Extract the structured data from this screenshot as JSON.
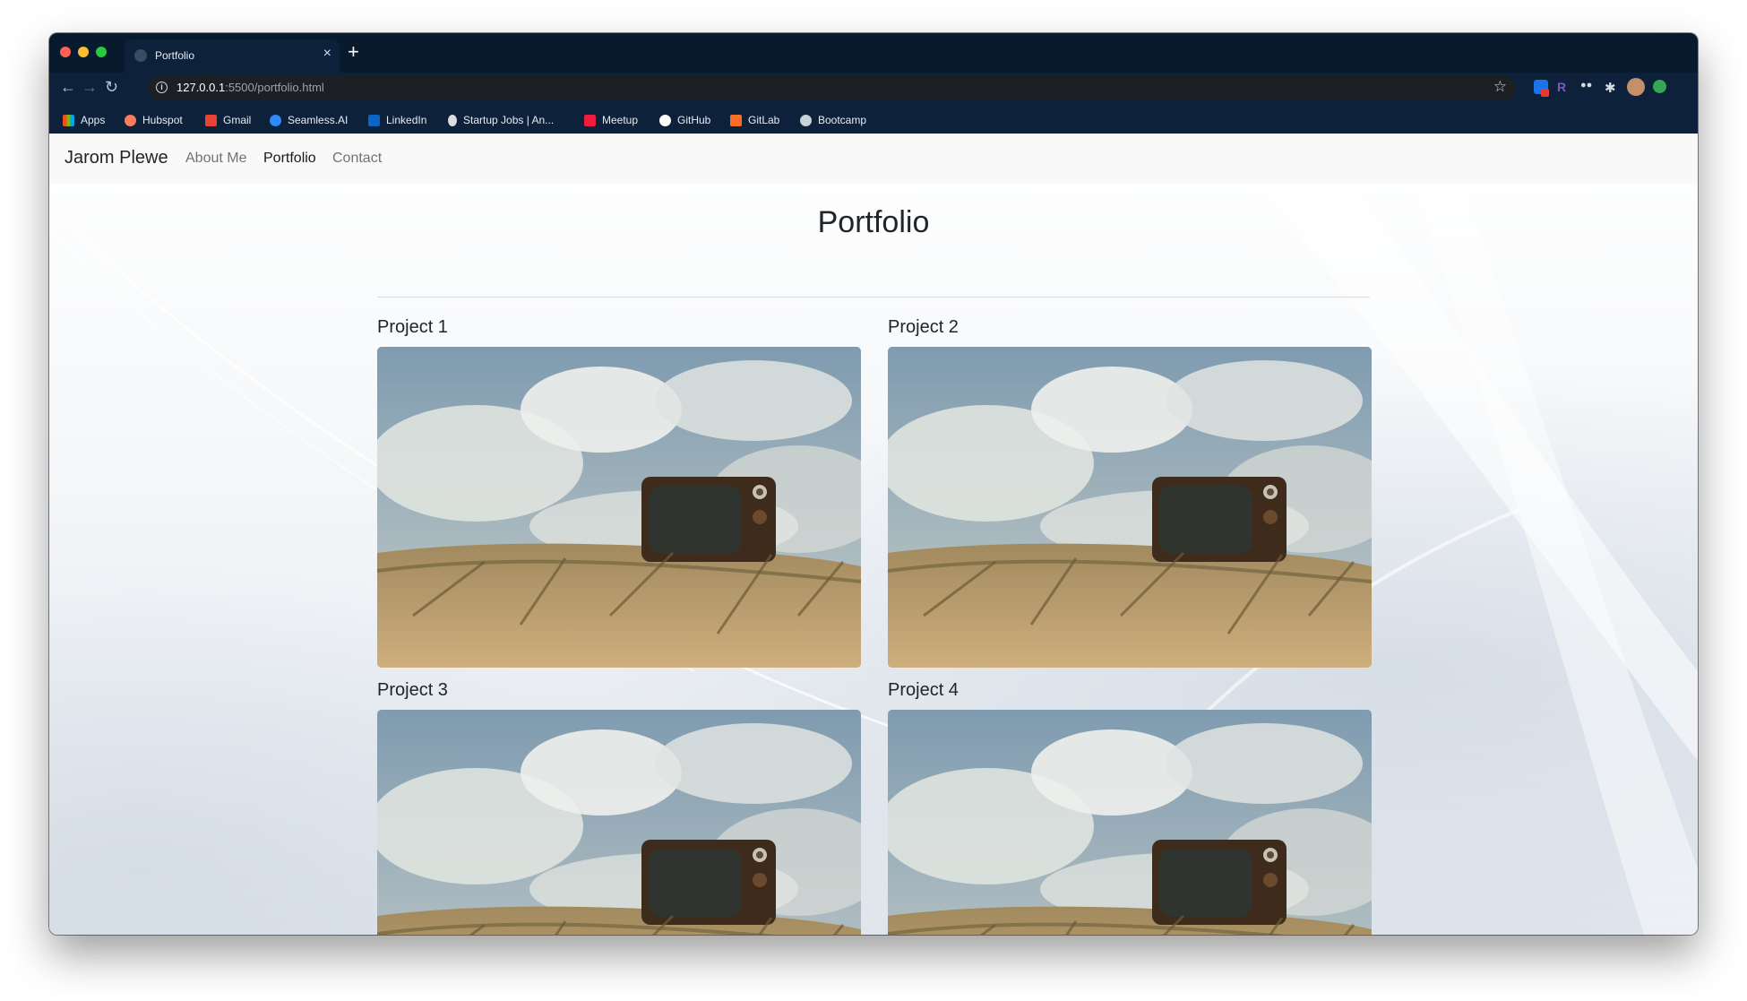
{
  "browser": {
    "tab_title": "Portfolio",
    "new_tab_symbol": "+",
    "tab_close_symbol": "×",
    "url_host": "127.0.0.1",
    "url_rest": ":5500/portfolio.html",
    "bookmarks": [
      {
        "label": "Apps",
        "icon": "apps-grid-icon",
        "color": "#f25022"
      },
      {
        "label": "Hubspot",
        "icon": "hubspot-icon",
        "color": "#ff7a59"
      },
      {
        "label": "Gmail",
        "icon": "gmail-icon",
        "color": "#ea4335"
      },
      {
        "label": "Seamless.AI",
        "icon": "seamless-search-icon",
        "color": "#2e8bff"
      },
      {
        "label": "LinkedIn",
        "icon": "linkedin-icon",
        "color": "#0a66c2"
      },
      {
        "label": "Startup Jobs | An...",
        "icon": "angellist-hand-icon",
        "color": "#dddddd"
      },
      {
        "label": "Meetup",
        "icon": "meetup-icon",
        "color": "#ed1c40"
      },
      {
        "label": "GitHub",
        "icon": "github-icon",
        "color": "#ffffff"
      },
      {
        "label": "GitLab",
        "icon": "gitlab-icon",
        "color": "#fc6d26"
      },
      {
        "label": "Bootcamp",
        "icon": "globe-icon",
        "color": "#c9d1d9"
      }
    ]
  },
  "site": {
    "brand": "Jarom Plewe",
    "nav": [
      {
        "label": "About Me",
        "active": false
      },
      {
        "label": "Portfolio",
        "active": true
      },
      {
        "label": "Contact",
        "active": false
      }
    ],
    "page_title": "Portfolio",
    "projects": [
      {
        "title": "Project 1",
        "image": "retro-tv-on-beach-photo"
      },
      {
        "title": "Project 2",
        "image": "retro-tv-on-beach-photo"
      },
      {
        "title": "Project 3",
        "image": "retro-tv-on-beach-photo"
      },
      {
        "title": "Project 4",
        "image": "retro-tv-on-beach-photo"
      }
    ]
  }
}
